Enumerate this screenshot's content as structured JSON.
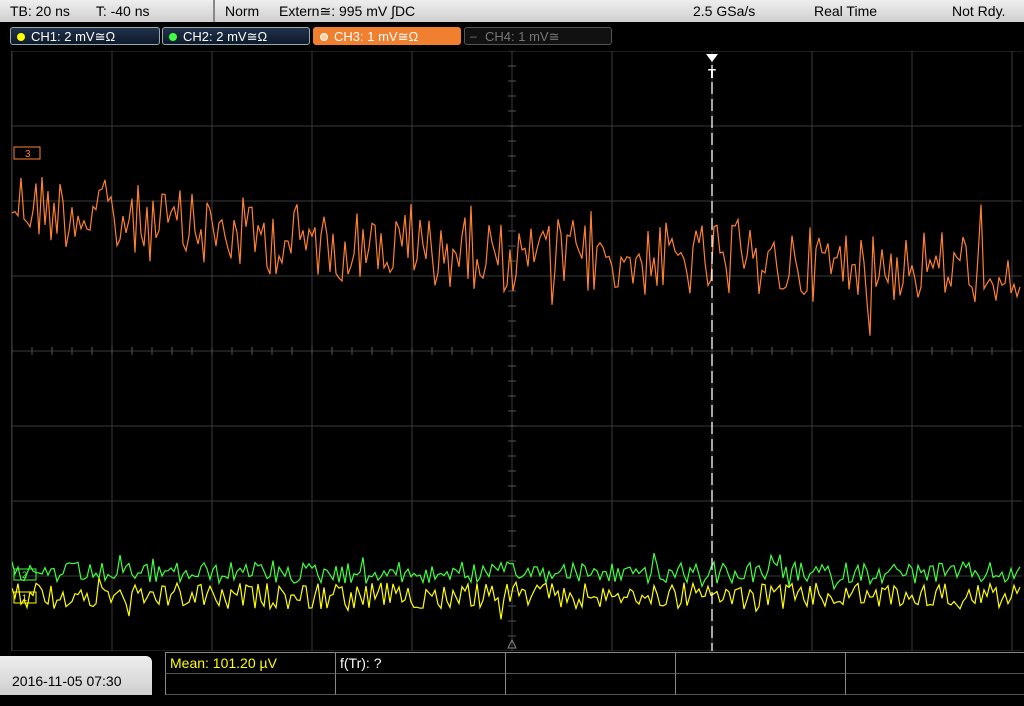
{
  "header": {
    "timebase": "TB: 20 ns",
    "trigger_time": "T: -40 ns",
    "trigger_mode": "Norm",
    "trigger_source": "Extern≅: 995 mV ∫DC",
    "sample_rate": "2.5 GSa/s",
    "acq_mode": "Real Time",
    "status": "Not Rdy."
  },
  "channels": [
    {
      "label": "CH1: 2 mV≅Ω",
      "color": "#ffff00",
      "state": "on"
    },
    {
      "label": "CH2: 2 mV≅Ω",
      "color": "#00ff00",
      "state": "on"
    },
    {
      "label": "CH3: 1 mV≅Ω",
      "color": "#ff8030",
      "state": "active"
    },
    {
      "label": "CH4: 1 mV≅",
      "color": "#777777",
      "state": "off"
    }
  ],
  "markers": {
    "ch3": "3",
    "ch2": "2",
    "ch1": "1",
    "trigger": "T"
  },
  "footer": {
    "datetime": "2016-11-05 07:30",
    "mean": "Mean: 101.20 µV",
    "ftr": "f(Tr): ?"
  },
  "colors": {
    "ch1": "#ffff00",
    "ch2": "#40ff40",
    "ch3": "#ff8030",
    "grid": "#3a3a3a"
  }
}
